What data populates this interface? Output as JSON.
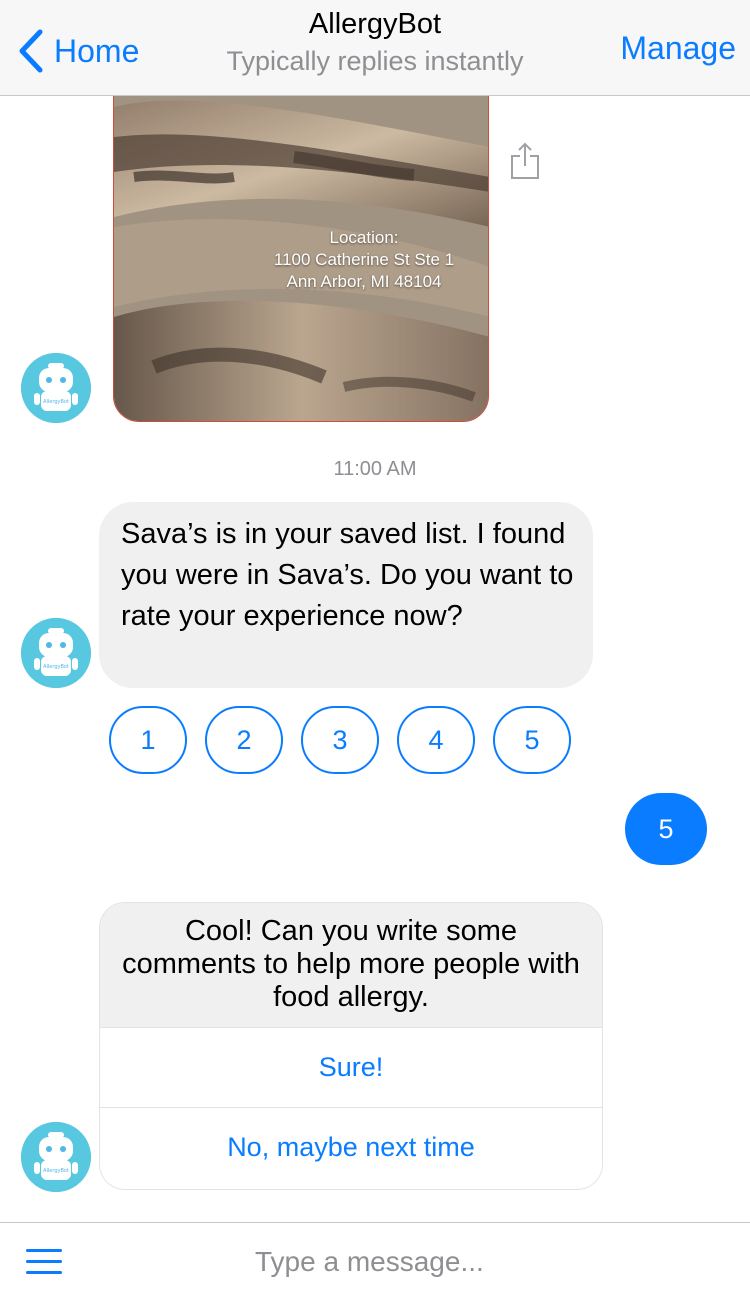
{
  "header": {
    "back_label": "Home",
    "title": "AllergyBot",
    "subtitle": "Typically replies instantly",
    "manage_label": "Manage"
  },
  "messages": {
    "location_card": {
      "label": "Location:",
      "line1": "1100 Catherine St Ste 1",
      "line2": "Ann Arbor, MI 48104"
    },
    "timestamp": "11:00 AM",
    "bot_message": "Sava’s is in your saved list. I found you were in Sava’s. Do you want to rate your experience now?",
    "rating_options": [
      "1",
      "2",
      "3",
      "4",
      "5"
    ],
    "user_reply": "5",
    "prompt_card": {
      "text": "Cool! Can you write some comments to help more people with food allergy.",
      "button_yes": "Sure!",
      "button_no": "No, maybe next time"
    }
  },
  "composer": {
    "placeholder": "Type a message..."
  },
  "bot_avatar": {
    "badge": "AllergyBot"
  },
  "colors": {
    "accent": "#0a7cff",
    "bubble_in": "#f1f0f0",
    "avatar_bg": "#56c8e0"
  },
  "icons": [
    "chevron-left-icon",
    "share-icon",
    "bot-avatar-icon",
    "hamburger-menu-icon"
  ]
}
